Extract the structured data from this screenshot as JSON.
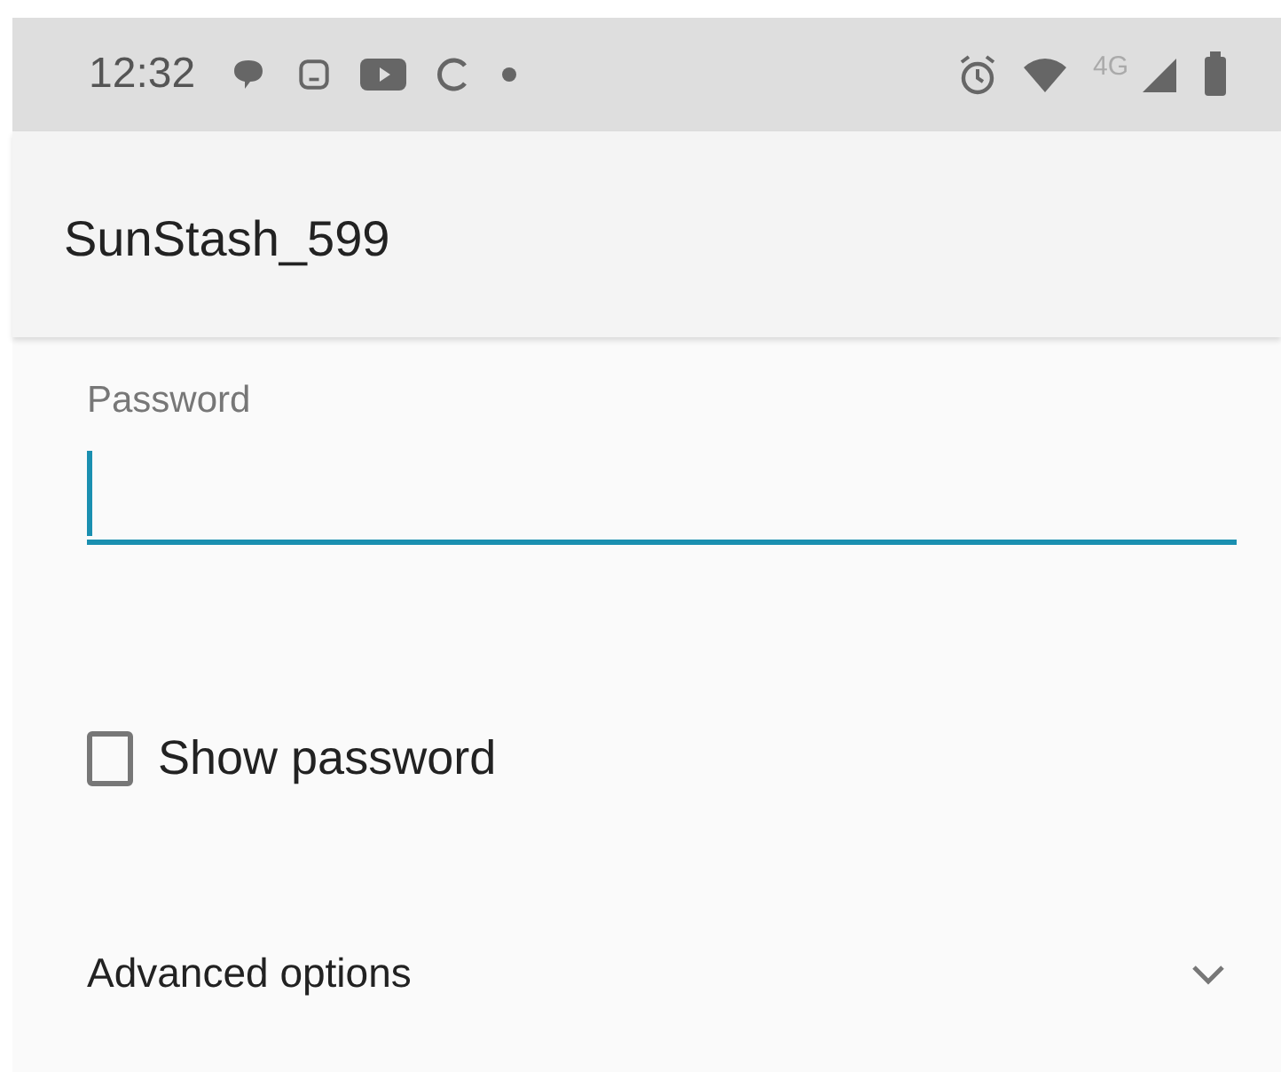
{
  "status_bar": {
    "time": "12:32",
    "network": "4G"
  },
  "app_bar": {
    "title": "SunStash_599"
  },
  "password_field": {
    "label": "Password",
    "focused": true
  },
  "show_password": {
    "label": "Show password",
    "checked": false
  },
  "advanced_options": {
    "label": "Advanced options",
    "expanded": false
  }
}
